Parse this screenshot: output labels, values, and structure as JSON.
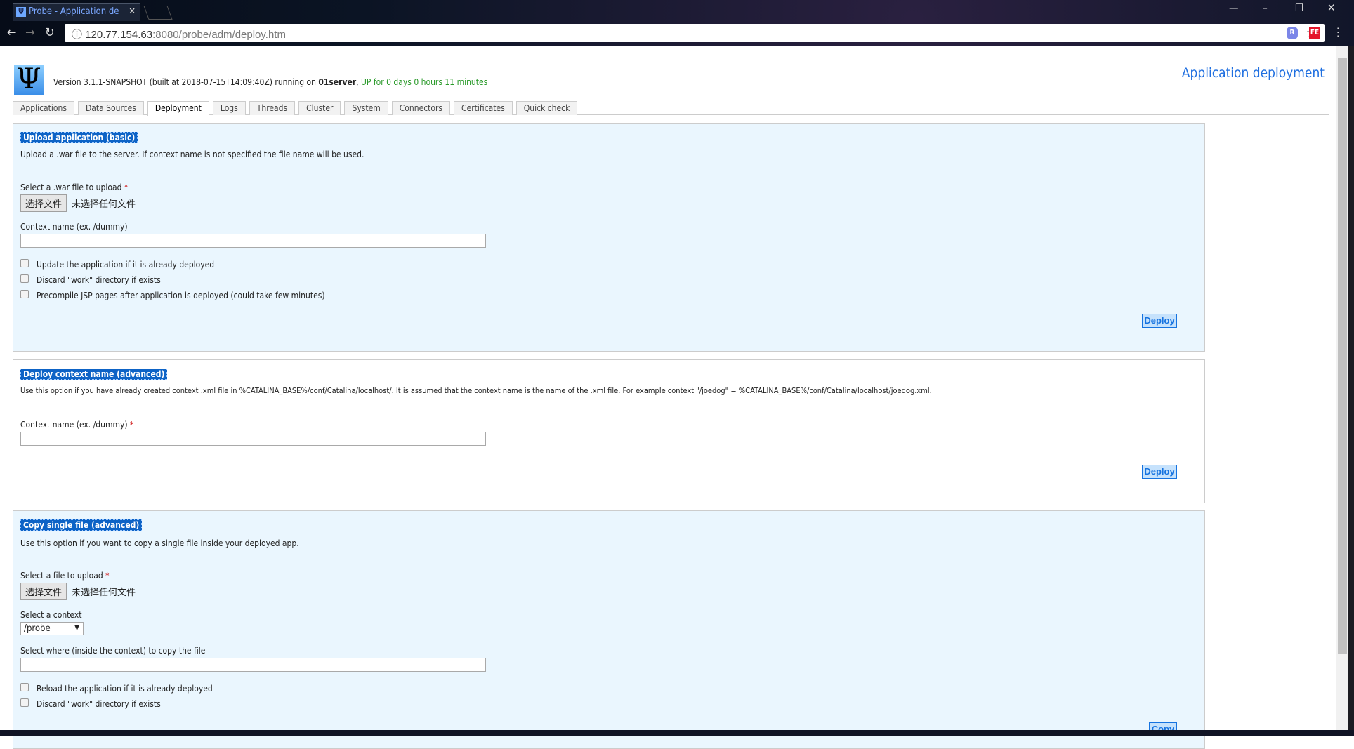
{
  "browser": {
    "tab_title": "Probe - Application de",
    "url_host": "120.77.154.63",
    "url_rest": ":8080/probe/adm/deploy.htm",
    "ext1": "R",
    "ext2": "FE"
  },
  "header": {
    "version_text": "Version 3.1.1-SNAPSHOT (built at 2018-07-15T14:09:40Z) running on ",
    "server": "01server",
    "sep": ", ",
    "uptime": "UP for 0 days 0 hours 11 minutes",
    "page_title": "Application deployment",
    "logo": "Ψ"
  },
  "tabs": [
    "Applications",
    "Data Sources",
    "Deployment",
    "Logs",
    "Threads",
    "Cluster",
    "System",
    "Connectors",
    "Certificates",
    "Quick check"
  ],
  "active_tab": "Deployment",
  "upload": {
    "legend": "Upload application (basic)",
    "desc": "Upload a .war file to the server. If context name is not specified the file name will be used.",
    "file_label": "Select a .war file to upload",
    "file_button": "选择文件",
    "file_none": "未选择任何文件",
    "context_label": "Context name (ex. /dummy)",
    "context_value": "",
    "checks": [
      "Update the application if it is already deployed",
      "Discard \"work\" directory if exists",
      "Precompile JSP pages after application is deployed (could take few minutes)"
    ],
    "button": "Deploy"
  },
  "deploy_context": {
    "legend": "Deploy context name (advanced)",
    "desc": "Use this option if you have already created context .xml file in %CATALINA_BASE%/conf/Catalina/localhost/. It is assumed that the context name is the name of the .xml file. For example context \"/joedog\" = %CATALINA_BASE%/conf/Catalina/localhost/joedog.xml.",
    "context_label": "Context name (ex. /dummy)",
    "context_value": "",
    "button": "Deploy"
  },
  "copy": {
    "legend": "Copy single file (advanced)",
    "desc": "Use this option if you want to copy a single file inside your deployed app.",
    "file_label": "Select a file to upload",
    "file_button": "选择文件",
    "file_none": "未选择任何文件",
    "context_label": "Select a context",
    "context_selected": "/probe",
    "where_label": "Select where (inside the context) to copy the file",
    "where_value": "",
    "checks": [
      "Reload the application if it is already deployed",
      "Discard \"work\" directory if exists"
    ],
    "button": "Copy"
  },
  "required_mark": "*",
  "colors": {
    "accent": "#0d63c6",
    "section_bg": "#eaf6fe",
    "uptime": "#2a9a2a",
    "title": "#1f6fe0"
  }
}
